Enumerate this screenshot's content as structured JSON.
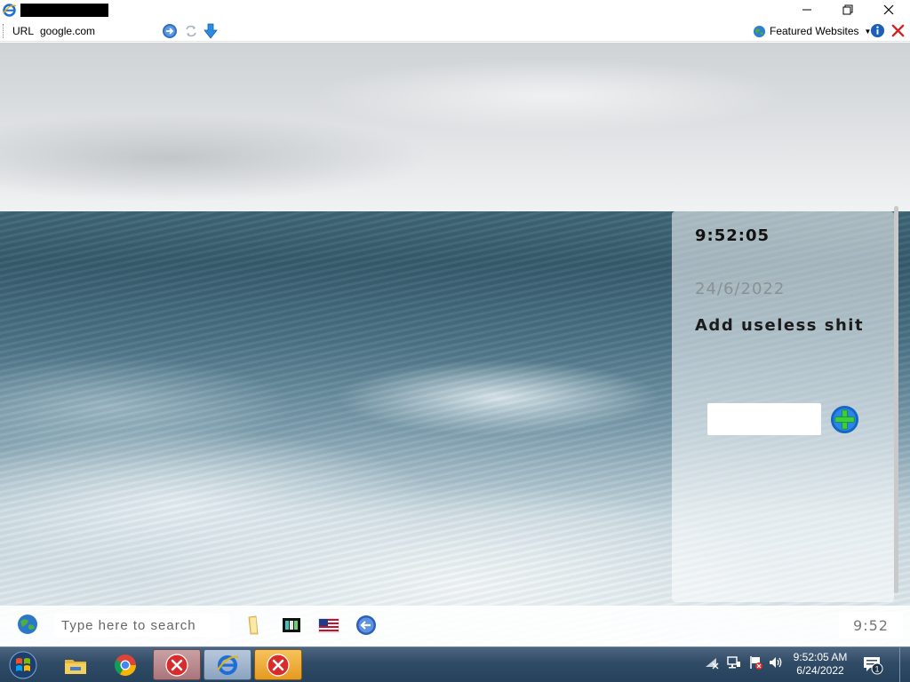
{
  "browser": {
    "url_label": "URL",
    "url_value": "google.com",
    "featured_label": "Featured Websites"
  },
  "widget": {
    "time": "9:52:05",
    "date": "24/6/2022",
    "heading": "Add useless shit",
    "input_value": ""
  },
  "dock": {
    "search_placeholder": "Type here to search",
    "time": "9:52"
  },
  "taskbar": {
    "clock_time": "9:52:05 AM",
    "clock_date": "6/24/2022",
    "notification_count": "1"
  },
  "colors": {
    "taskbar_bg": "#304b66",
    "error_red": "#d92b2b",
    "add_button_blue": "#1e73d8",
    "add_button_plus": "#3ccf3c"
  }
}
